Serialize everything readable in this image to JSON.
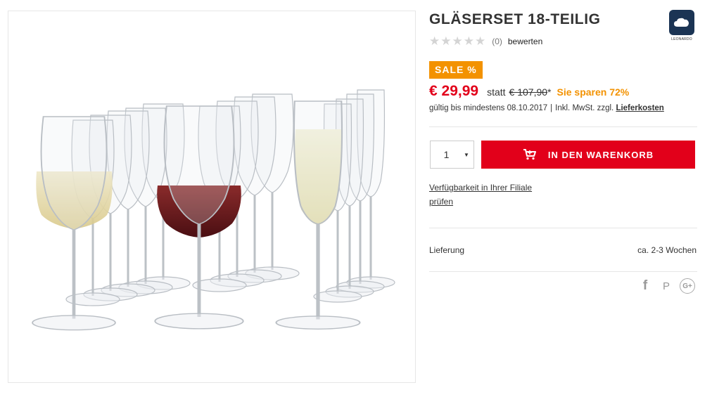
{
  "product": {
    "title": "GLÄSERSET 18-TEILIG",
    "image_alt": "Gläserset mit Weißwein-, Rotwein- und Sektgläsern"
  },
  "brand": {
    "name": "LEONARDO",
    "logo_icon": "cloud-logo-icon",
    "color": "#1b3454"
  },
  "rating": {
    "stars": "★★★★★",
    "count_text": "(0)",
    "rate_label": "bewerten"
  },
  "sale_badge": "SALE %",
  "pricing": {
    "price": "€ 29,99",
    "statt": "statt",
    "old_price": "€ 107,90",
    "asterisk": "*",
    "savings": "Sie sparen 72%",
    "accent_red": "#e2001a",
    "accent_orange": "#f39200"
  },
  "validity": {
    "text": "gültig bis mindestens 08.10.2017",
    "separator": "|",
    "tax_text": "Inkl. MwSt. zzgl.",
    "shipping_link": "Lieferkosten"
  },
  "quantity": {
    "value": "1",
    "arrow_icon": "caret-down-icon"
  },
  "cart_button": {
    "label": "IN DEN WARENKORB",
    "icon": "shopping-cart-icon"
  },
  "availability": {
    "line1": "Verfügbarkeit in Ihrer Filiale",
    "line2": "prüfen"
  },
  "delivery": {
    "label": "Lieferung",
    "value": "ca. 2-3 Wochen"
  },
  "social": {
    "facebook": "f",
    "pinterest": "P",
    "googleplus": "G+"
  }
}
